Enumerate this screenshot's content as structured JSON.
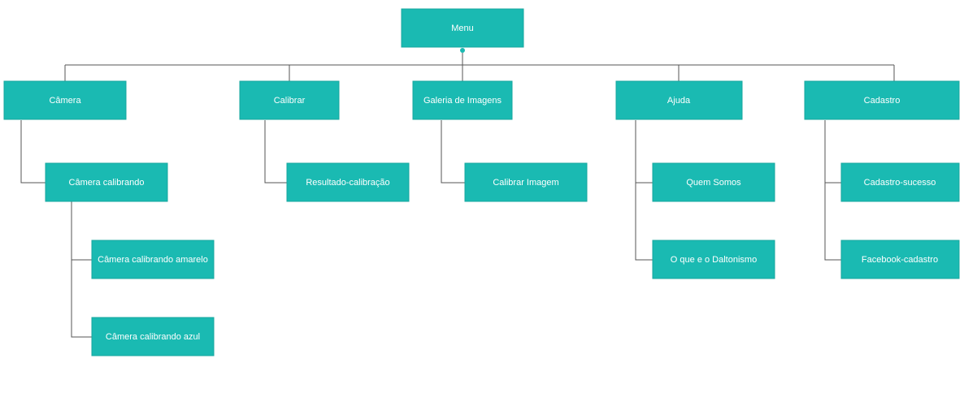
{
  "colors": {
    "node_fill": "#1abab2",
    "node_stroke": "#17a79f",
    "connector": "#555555",
    "text": "#ffffff"
  },
  "root": {
    "label": "Menu"
  },
  "branches": [
    {
      "label": "Câmera",
      "children": [
        {
          "label": "Câmera calibrando",
          "children": [
            {
              "label": "Câmera calibrando amarelo"
            },
            {
              "label": "Câmera calibrando azul"
            }
          ]
        }
      ]
    },
    {
      "label": "Calibrar",
      "children": [
        {
          "label": "Resultado-calibração"
        }
      ]
    },
    {
      "label": "Galeria de Imagens",
      "children": [
        {
          "label": "Calibrar Imagem"
        }
      ]
    },
    {
      "label": "Ajuda",
      "children": [
        {
          "label": "Quem Somos"
        },
        {
          "label": "O que e o Daltonismo"
        }
      ]
    },
    {
      "label": "Cadastro",
      "children": [
        {
          "label": "Cadastro-sucesso"
        },
        {
          "label": "Facebook-cadastro"
        }
      ]
    }
  ]
}
